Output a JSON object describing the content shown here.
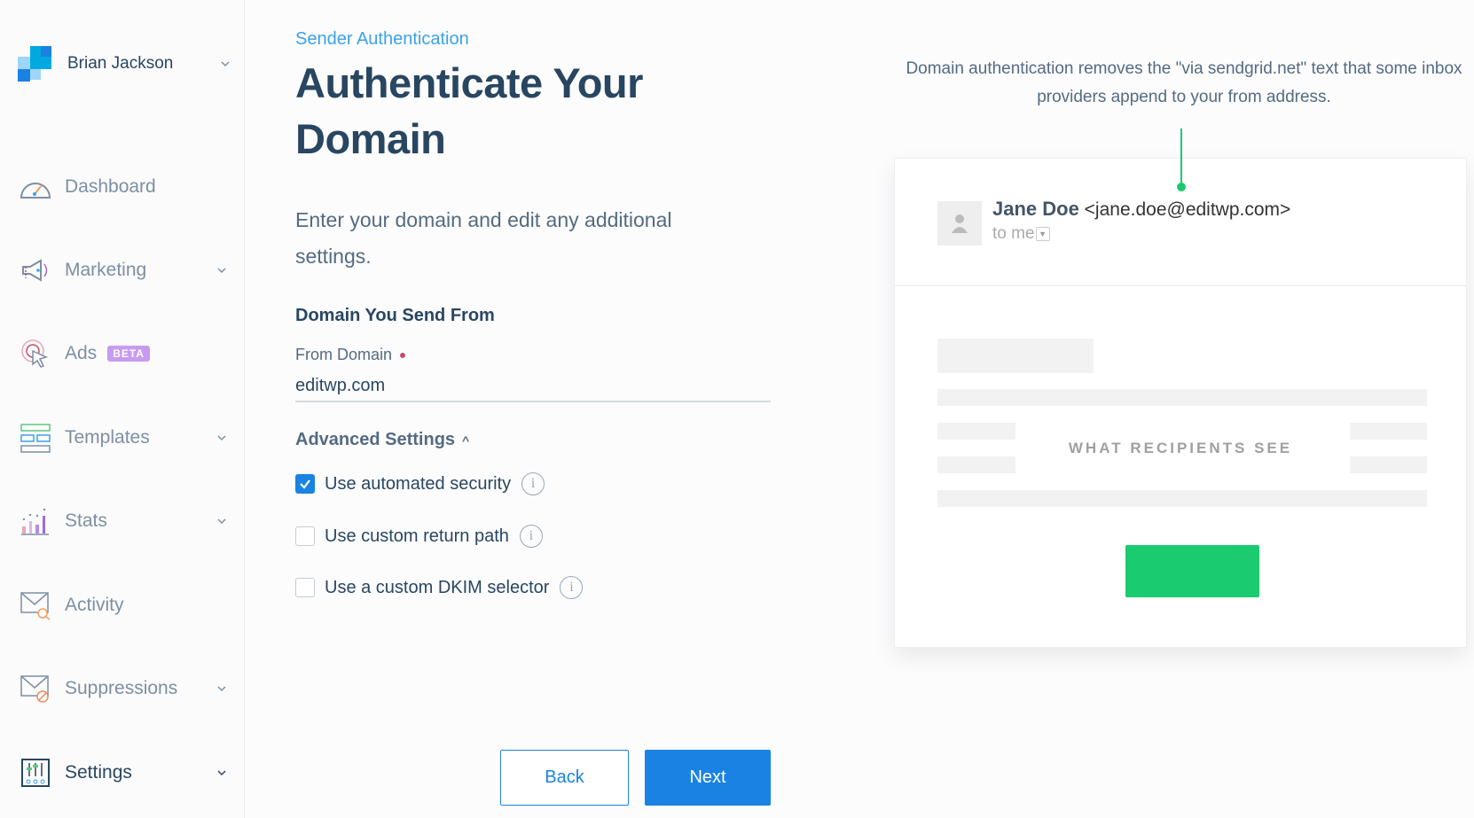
{
  "account": {
    "name": "Brian Jackson"
  },
  "sidebar": {
    "items": [
      {
        "label": "Dashboard",
        "icon": "dashboard-gauge-icon",
        "has_chevron": false
      },
      {
        "label": "Marketing",
        "icon": "megaphone-icon",
        "has_chevron": true
      },
      {
        "label": "Ads",
        "icon": "target-cursor-icon",
        "badge": "BETA",
        "has_chevron": false
      },
      {
        "label": "Templates",
        "icon": "templates-layout-icon",
        "has_chevron": true
      },
      {
        "label": "Stats",
        "icon": "bar-chart-icon",
        "has_chevron": true
      },
      {
        "label": "Activity",
        "icon": "envelope-search-icon",
        "has_chevron": false
      },
      {
        "label": "Suppressions",
        "icon": "envelope-blocked-icon",
        "has_chevron": true
      },
      {
        "label": "Settings",
        "icon": "settings-sliders-icon",
        "has_chevron": true,
        "active": true
      }
    ]
  },
  "main": {
    "breadcrumb": "Sender Authentication",
    "title": "Authenticate Your Domain",
    "intro": "Enter your domain and edit any additional settings.",
    "section_heading": "Domain You Send From",
    "from_domain": {
      "label": "From Domain",
      "required": true,
      "value": "editwp.com"
    },
    "advanced": {
      "label": "Advanced Settings",
      "expanded": true,
      "options": [
        {
          "label": "Use automated security",
          "checked": true
        },
        {
          "label": "Use custom return path",
          "checked": false
        },
        {
          "label": "Use a custom DKIM selector",
          "checked": false
        }
      ]
    },
    "buttons": {
      "back": "Back",
      "next": "Next"
    }
  },
  "preview": {
    "caption": "Domain authentication removes the \"via sendgrid.net\" text that some inbox providers append to your from address.",
    "sender_name": "Jane Doe",
    "sender_email": "<jane.doe@editwp.com>",
    "to_line": "to me",
    "overlay_label": "WHAT RECIPIENTS SEE"
  },
  "colors": {
    "primary": "#1a82e2",
    "accent_green": "#1bc96e",
    "heading": "#294661",
    "beta_badge": "#c89bf0"
  }
}
